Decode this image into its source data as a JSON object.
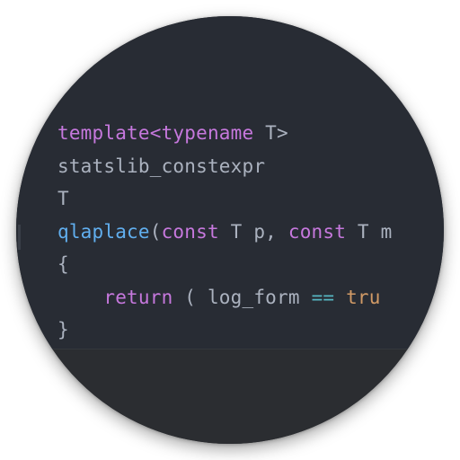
{
  "code_lines": [
    [
      {
        "t": "template<typename",
        "c": "kw"
      },
      {
        "t": " T>",
        "c": "plain"
      }
    ],
    [
      {
        "t": "statslib_constexpr",
        "c": "plain"
      }
    ],
    [
      {
        "t": "T",
        "c": "plain"
      }
    ],
    [
      {
        "t": "qlaplace",
        "c": "fn"
      },
      {
        "t": "(",
        "c": "plain"
      },
      {
        "t": "const",
        "c": "kw"
      },
      {
        "t": " T p, ",
        "c": "plain"
      },
      {
        "t": "const",
        "c": "kw"
      },
      {
        "t": " T m",
        "c": "plain"
      }
    ],
    [
      {
        "t": "{",
        "c": "plain"
      }
    ],
    [
      {
        "t": "    ",
        "c": "plain"
      },
      {
        "t": "return",
        "c": "kw"
      },
      {
        "t": " ( log_form ",
        "c": "plain"
      },
      {
        "t": "==",
        "c": "op"
      },
      {
        "t": " ",
        "c": "plain"
      },
      {
        "t": "tru",
        "c": "lit"
      }
    ],
    [
      {
        "t": "}",
        "c": "plain"
      }
    ]
  ],
  "theme": {
    "keyword": "#c678dd",
    "function": "#61afef",
    "operator": "#56b6c2",
    "literal": "#d19a66",
    "text": "#abb2bf",
    "background": "#282c34"
  }
}
